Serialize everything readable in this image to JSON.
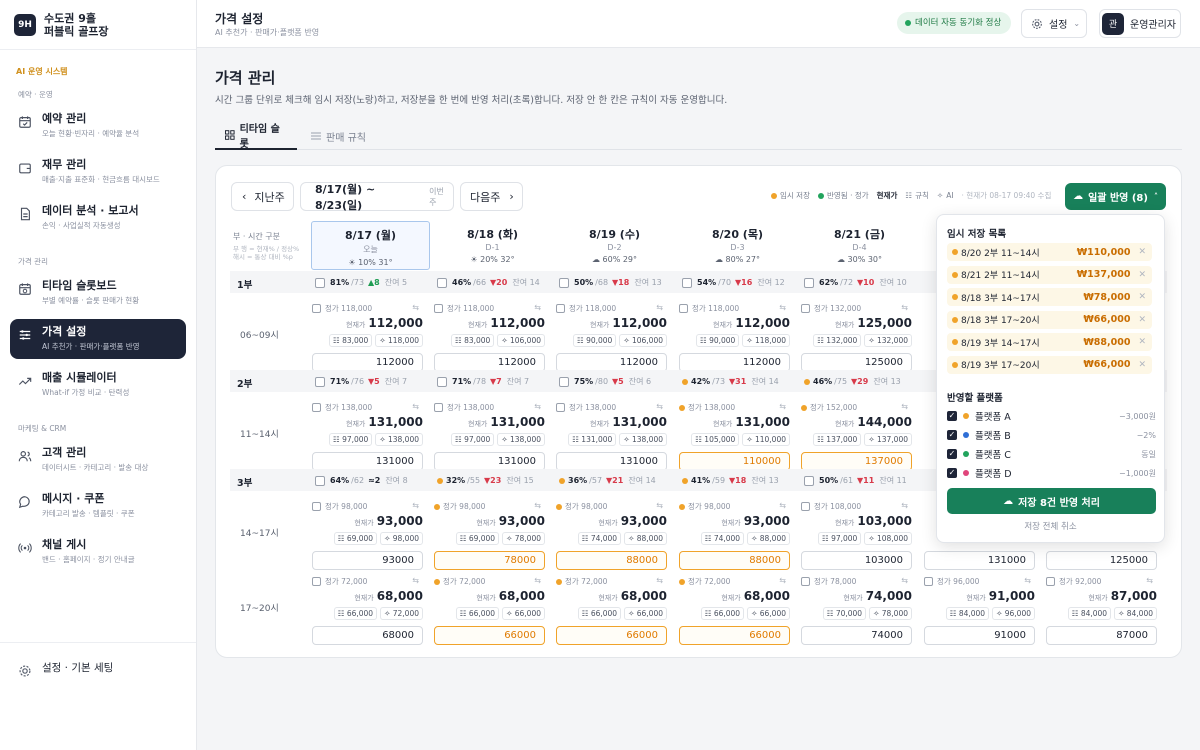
{
  "sidebar": {
    "brand_logo": "9H",
    "brand_name": "수도권 9홀\n퍼블릭 골프장",
    "section_title": "AI 운영 시스템",
    "groups": [
      {
        "label": "예약 · 운영",
        "items": [
          {
            "title": "예약 관리",
            "sub": "오늘 현황·빈자리 · 예약율 분석",
            "icon": "calendar-check-icon"
          },
          {
            "title": "재무 관리",
            "sub": "매출·지출 표준화 · 현금흐름 대시보드",
            "icon": "wallet-icon"
          },
          {
            "title": "데이터 분석 · 보고서",
            "sub": "손익 · 사업실적 자동생성",
            "icon": "document-icon"
          }
        ]
      },
      {
        "label": "가격 관리",
        "items": [
          {
            "title": "티타임 슬롯보드",
            "sub": "부별 예약률 · 슬롯 판매가 현황",
            "icon": "calendar-clock-icon"
          },
          {
            "title": "가격 설정",
            "sub": "AI 추천가 · 판매가·플랫폼 반영",
            "icon": "sliders-icon",
            "active": true
          },
          {
            "title": "매출 시뮬레이터",
            "sub": "What-if 가정 비교 · 탄력성",
            "icon": "trend-icon"
          }
        ]
      },
      {
        "label": "마케팅 & CRM",
        "items": [
          {
            "title": "고객 관리",
            "sub": "데이터시트 · 카테고리 · 발송 대상",
            "icon": "users-icon"
          },
          {
            "title": "메시지 · 쿠폰",
            "sub": "카테고리 발송 · 템플릿 · 쿠폰",
            "icon": "message-icon"
          },
          {
            "title": "채널 게시",
            "sub": "밴드 · 홈페이지 · 정기 안내글",
            "icon": "broadcast-icon"
          }
        ]
      }
    ],
    "bottom": {
      "title": "설정 · 기본 세팅",
      "icon": "gear-icon"
    }
  },
  "topbar": {
    "title": "가격 설정",
    "subtitle": "AI 추천가 · 판매가·플랫폼 반영",
    "sync": "데이터 자동 동기화 정상",
    "settings": "설정",
    "avatar": "관",
    "user": "운영관리자"
  },
  "page": {
    "title": "가격 관리",
    "desc": "시간 그룹 단위로 체크해 임시 저장(노랑)하고, 저장분을 한 번에 반영 처리(초록)합니다. 저장 안 한 칸은 규칙이 자동 운영합니다.",
    "tabs": [
      "티타임 슬롯",
      "판매 규칙"
    ]
  },
  "toolbar": {
    "prev": "지난주",
    "range": "8/17(월) ~ 8/23(일)",
    "range_note": "이번 주",
    "next": "다음주",
    "legend": [
      "임시 저장",
      "반영됨 · 정가",
      "현재가",
      "규칙",
      "AI",
      "· 현재가 08-17 09:40 수집"
    ],
    "apply": "일괄 반영 (8)"
  },
  "grid": {
    "corner_title": "부 · 시간 구분",
    "corner_note": "부 행 = 현재% / 정상%\n해시 = 통상 대비 %p",
    "days": [
      {
        "date": "8/17 (월)",
        "rel": "오늘",
        "weather": "☀ 10% 31°",
        "today": true
      },
      {
        "date": "8/18 (화)",
        "rel": "D-1",
        "weather": "☀ 20% 32°"
      },
      {
        "date": "8/19 (수)",
        "rel": "D-2",
        "weather": "☁ 60% 29°"
      },
      {
        "date": "8/20 (목)",
        "rel": "D-3",
        "weather": "☁ 80% 27°"
      },
      {
        "date": "8/21 (금)",
        "rel": "D-4",
        "weather": "☁ 30% 30°"
      }
    ],
    "sessions": [
      {
        "name": "1부",
        "summary": [
          {
            "occ": "81%",
            "base": "/73",
            "delta": "▲8",
            "dir": "up",
            "rem": "잔여 5",
            "cb": true
          },
          {
            "occ": "46%",
            "base": "/66",
            "delta": "▼20",
            "dir": "dn",
            "rem": "잔여 14",
            "cb": true
          },
          {
            "occ": "50%",
            "base": "/68",
            "delta": "▼18",
            "dir": "dn",
            "rem": "잔여 13",
            "cb": true
          },
          {
            "occ": "54%",
            "base": "/70",
            "delta": "▼16",
            "dir": "dn",
            "rem": "잔여 12",
            "cb": true
          },
          {
            "occ": "62%",
            "base": "/72",
            "delta": "▼10",
            "dir": "dn",
            "rem": "잔여 10",
            "cb": true
          }
        ],
        "rows": [
          {
            "time": "06~09시",
            "cells": [
              {
                "base": "정가 118,000",
                "cur": "112,000",
                "c1": "83,000",
                "c2": "118,000",
                "input": "112000"
              },
              {
                "base": "정가 118,000",
                "cur": "112,000",
                "c1": "83,000",
                "c2": "106,000",
                "input": "112000"
              },
              {
                "base": "정가 118,000",
                "cur": "112,000",
                "c1": "90,000",
                "c2": "106,000",
                "input": "112000"
              },
              {
                "base": "정가 118,000",
                "cur": "112,000",
                "c1": "90,000",
                "c2": "118,000",
                "input": "112000"
              },
              {
                "base": "정가 132,000",
                "cur": "125,000",
                "c1": "132,000",
                "c2": "132,000",
                "input": "125000"
              }
            ]
          }
        ]
      },
      {
        "name": "2부",
        "summary": [
          {
            "occ": "71%",
            "base": "/76",
            "delta": "▼5",
            "dir": "dn",
            "rem": "잔여 7",
            "cb": true
          },
          {
            "occ": "71%",
            "base": "/78",
            "delta": "▼7",
            "dir": "dn",
            "rem": "잔여 7",
            "cb": true
          },
          {
            "occ": "75%",
            "base": "/80",
            "delta": "▼5",
            "dir": "dn",
            "rem": "잔여 6",
            "cb": true
          },
          {
            "occ": "42%",
            "base": "/73",
            "delta": "▼31",
            "dir": "dn",
            "rem": "잔여 14",
            "cb": false
          },
          {
            "occ": "46%",
            "base": "/75",
            "delta": "▼29",
            "dir": "dn",
            "rem": "잔여 13",
            "cb": false
          }
        ],
        "rows": [
          {
            "time": "11~14시",
            "cells": [
              {
                "base": "정가 138,000",
                "cur": "131,000",
                "c1": "97,000",
                "c2": "138,000",
                "input": "131000"
              },
              {
                "base": "정가 138,000",
                "cur": "131,000",
                "c1": "97,000",
                "c2": "138,000",
                "input": "131000"
              },
              {
                "base": "정가 138,000",
                "cur": "131,000",
                "c1": "131,000",
                "c2": "138,000",
                "input": "131000"
              },
              {
                "base": "정가 138,000",
                "cur": "131,000",
                "c1": "105,000",
                "c2": "110,000",
                "input": "110000",
                "saved": true
              },
              {
                "base": "정가 152,000",
                "cur": "144,000",
                "c1": "137,000",
                "c2": "137,000",
                "input": "137000",
                "saved": true
              }
            ]
          }
        ]
      },
      {
        "name": "3부",
        "summary": [
          {
            "occ": "64%",
            "base": "/62",
            "delta": "≈2",
            "dir": "eq",
            "rem": "잔여 8",
            "cb": true
          },
          {
            "occ": "32%",
            "base": "/55",
            "delta": "▼23",
            "dir": "dn",
            "rem": "잔여 15",
            "cb": false
          },
          {
            "occ": "36%",
            "base": "/57",
            "delta": "▼21",
            "dir": "dn",
            "rem": "잔여 14",
            "cb": false
          },
          {
            "occ": "41%",
            "base": "/59",
            "delta": "▼18",
            "dir": "dn",
            "rem": "잔여 13",
            "cb": false
          },
          {
            "occ": "50%",
            "base": "/61",
            "delta": "▼11",
            "dir": "dn",
            "rem": "잔여 11",
            "cb": true
          }
        ],
        "rows": [
          {
            "time": "14~17시",
            "cells": [
              {
                "base": "정가 98,000",
                "cur": "93,000",
                "c1": "69,000",
                "c2": "98,000",
                "input": "93000"
              },
              {
                "base": "정가 98,000",
                "cur": "93,000",
                "c1": "69,000",
                "c2": "78,000",
                "input": "78000",
                "saved": true
              },
              {
                "base": "정가 98,000",
                "cur": "93,000",
                "c1": "74,000",
                "c2": "88,000",
                "input": "88000",
                "saved": true
              },
              {
                "base": "정가 98,000",
                "cur": "93,000",
                "c1": "74,000",
                "c2": "88,000",
                "input": "88000",
                "saved": true
              },
              {
                "base": "정가 108,000",
                "cur": "103,000",
                "c1": "97,000",
                "c2": "108,000",
                "input": "103000"
              }
            ],
            "extra": [
              {
                "input": "131000"
              },
              {
                "input": "125000"
              }
            ]
          },
          {
            "time": "17~20시",
            "cells": [
              {
                "base": "정가 72,000",
                "cur": "68,000",
                "c1": "66,000",
                "c2": "72,000",
                "input": "68000"
              },
              {
                "base": "정가 72,000",
                "cur": "68,000",
                "c1": "66,000",
                "c2": "66,000",
                "input": "66000",
                "saved": true
              },
              {
                "base": "정가 72,000",
                "cur": "68,000",
                "c1": "66,000",
                "c2": "66,000",
                "input": "66000",
                "saved": true
              },
              {
                "base": "정가 72,000",
                "cur": "68,000",
                "c1": "66,000",
                "c2": "66,000",
                "input": "66000",
                "saved": true
              },
              {
                "base": "정가 78,000",
                "cur": "74,000",
                "c1": "70,000",
                "c2": "78,000",
                "input": "74000"
              }
            ],
            "extra": [
              {
                "base": "정가 96,000",
                "cur": "91,000",
                "c1": "84,000",
                "c2": "96,000",
                "input": "91000"
              },
              {
                "base": "정가 92,000",
                "cur": "87,000",
                "c1": "84,000",
                "c2": "84,000",
                "input": "87000"
              }
            ]
          }
        ]
      }
    ]
  },
  "dropdown": {
    "saved_title": "임시 저장 목록",
    "saved": [
      {
        "label": "8/20 2부 11~14시",
        "price": "₩110,000"
      },
      {
        "label": "8/21 2부 11~14시",
        "price": "₩137,000"
      },
      {
        "label": "8/18 3부 14~17시",
        "price": "₩78,000"
      },
      {
        "label": "8/18 3부 17~20시",
        "price": "₩66,000"
      },
      {
        "label": "8/19 3부 14~17시",
        "price": "₩88,000"
      },
      {
        "label": "8/19 3부 17~20시",
        "price": "₩66,000"
      }
    ],
    "platform_title": "반영할 플랫폼",
    "platforms": [
      {
        "name": "플랫폼 A",
        "adj": "−3,000원",
        "color": "#f0a32a"
      },
      {
        "name": "플랫폼 B",
        "adj": "−2%",
        "color": "#2f6fd6"
      },
      {
        "name": "플랫폼 C",
        "adj": "동일",
        "color": "#22a45d"
      },
      {
        "name": "플랫폼 D",
        "adj": "−1,000원",
        "color": "#e0457b"
      }
    ],
    "process": "저장 8건 반영 처리",
    "cancel": "저장 전체 취소"
  },
  "colors": {
    "navy": "#1e2538",
    "green": "#18805a",
    "orange": "#f0a32a",
    "red": "#d83a4a"
  }
}
